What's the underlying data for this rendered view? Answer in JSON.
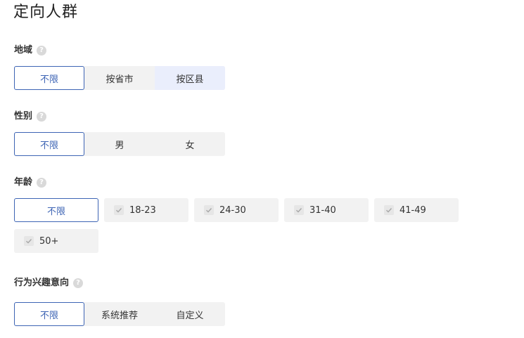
{
  "page": {
    "title": "定向人群"
  },
  "region": {
    "label": "地域",
    "options": [
      "不限",
      "按省市",
      "按区县"
    ],
    "selected": "不限"
  },
  "gender": {
    "label": "性别",
    "options": [
      "不限",
      "男",
      "女"
    ],
    "selected": "不限"
  },
  "age": {
    "label": "年龄",
    "options": [
      "不限",
      "18-23",
      "24-30",
      "31-40",
      "41-49",
      "50+"
    ],
    "selected": "不限"
  },
  "interest": {
    "label": "行为兴趣意向",
    "options": [
      "不限",
      "系统推荐",
      "自定义"
    ],
    "selected": "不限"
  },
  "icons": {
    "help": "question-circle-icon",
    "check": "check-icon"
  },
  "colors": {
    "accent": "#3d64b4",
    "option_bg": "#f2f2f2",
    "hover_bg": "#eaeefc"
  }
}
